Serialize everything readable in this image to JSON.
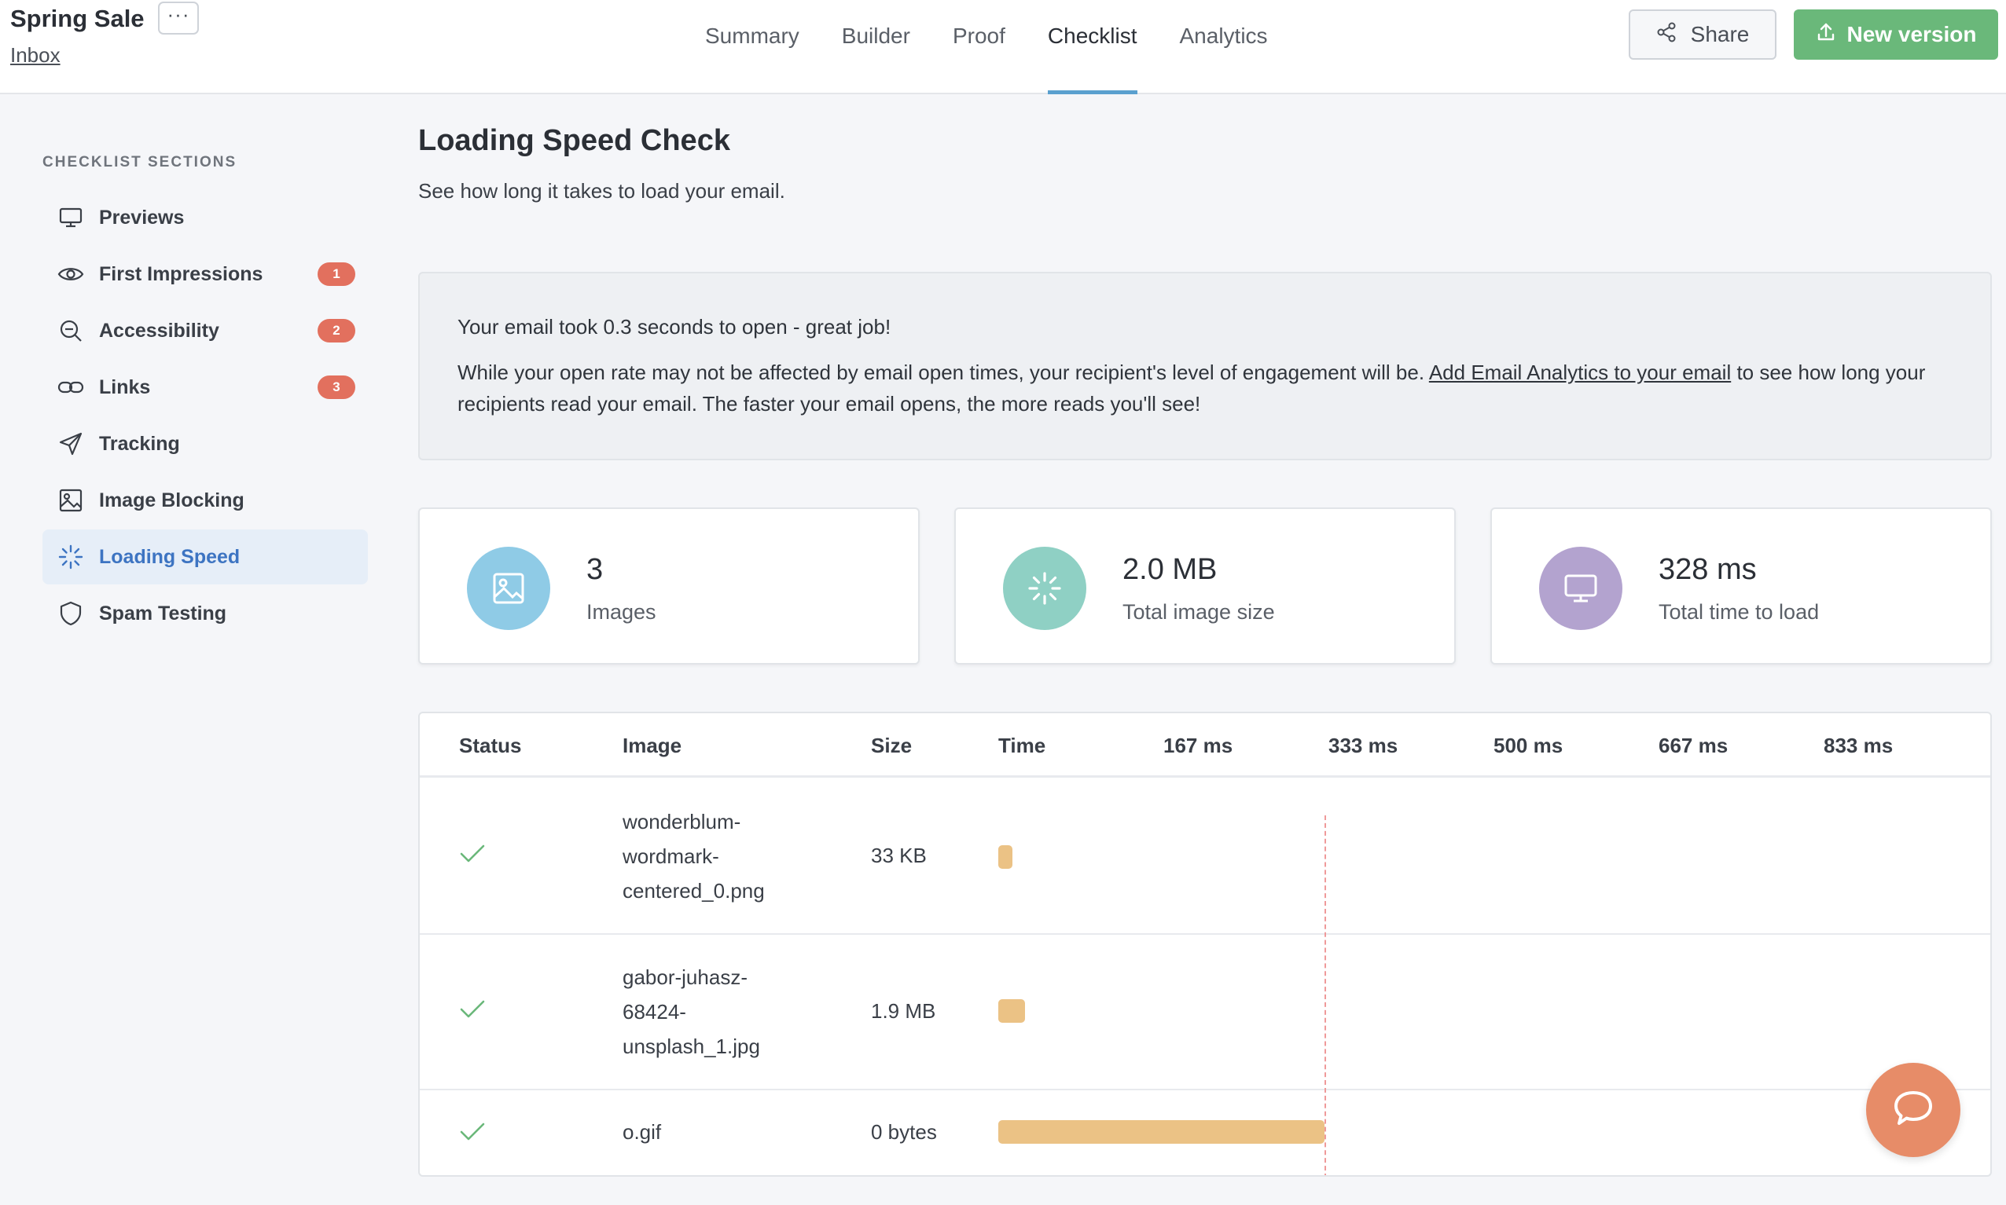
{
  "header": {
    "project_title": "Spring Sale",
    "more_label": "···",
    "breadcrumb": "Inbox",
    "tabs": [
      {
        "label": "Summary"
      },
      {
        "label": "Builder"
      },
      {
        "label": "Proof"
      },
      {
        "label": "Checklist",
        "active": true
      },
      {
        "label": "Analytics"
      }
    ],
    "share_label": "Share",
    "new_version_label": "New version"
  },
  "sidebar": {
    "heading": "CHECKLIST SECTIONS",
    "items": [
      {
        "label": "Previews",
        "icon": "monitor-icon"
      },
      {
        "label": "First Impressions",
        "icon": "eye-icon",
        "badge": "1"
      },
      {
        "label": "Accessibility",
        "icon": "magnifier-icon",
        "badge": "2"
      },
      {
        "label": "Links",
        "icon": "link-icon",
        "badge": "3"
      },
      {
        "label": "Tracking",
        "icon": "paper-plane-icon"
      },
      {
        "label": "Image Blocking",
        "icon": "image-icon"
      },
      {
        "label": "Loading Speed",
        "icon": "spinner-icon",
        "active": true
      },
      {
        "label": "Spam Testing",
        "icon": "shield-icon"
      }
    ]
  },
  "main": {
    "title": "Loading Speed Check",
    "subtitle": "See how long it takes to load your email.",
    "info": {
      "line1": "Your email took 0.3 seconds to open - great job!",
      "line2_before": "While your open rate may not be affected by email open times, your recipient's level of engagement will be. ",
      "line2_link": "Add Email Analytics to your email",
      "line2_after": " to see how long your recipients read your email. The faster your email opens, the more reads you'll see!"
    },
    "stats": [
      {
        "value": "3",
        "label": "Images",
        "icon": "image-icon",
        "color": "#8fcbe6"
      },
      {
        "value": "2.0 MB",
        "label": "Total image size",
        "icon": "spinner-icon",
        "color": "#8fd0c4"
      },
      {
        "value": "328 ms",
        "label": "Total time to load",
        "icon": "monitor-icon",
        "color": "#b3a3cf"
      }
    ],
    "table": {
      "headers": {
        "status": "Status",
        "image": "Image",
        "size": "Size",
        "time": "Time",
        "ticks": [
          "167 ms",
          "333 ms",
          "500 ms",
          "667 ms",
          "833 ms"
        ]
      },
      "rows": [
        {
          "status": "ok",
          "image": "wonderblum-wordmark-centered_0.png",
          "size": "33 KB",
          "bar_start_ms": 0,
          "bar_end_ms": 10
        },
        {
          "status": "ok",
          "image": "gabor-juhasz-68424-unsplash_1.jpg",
          "size": "1.9 MB",
          "bar_start_ms": 0,
          "bar_end_ms": 27
        },
        {
          "status": "ok",
          "image": "o.gif",
          "size": "0 bytes",
          "bar_start_ms": 0,
          "bar_end_ms": 328
        }
      ],
      "marker_ms": 328
    }
  },
  "colors": {
    "accent": "#5aa0cf",
    "primary_button": "#6ab87a",
    "badge": "#e2705e",
    "bar": "#ebc285",
    "check": "#6ab87a",
    "chat_button": "#e78c68"
  },
  "chat_icon": "chat-bubble-icon"
}
